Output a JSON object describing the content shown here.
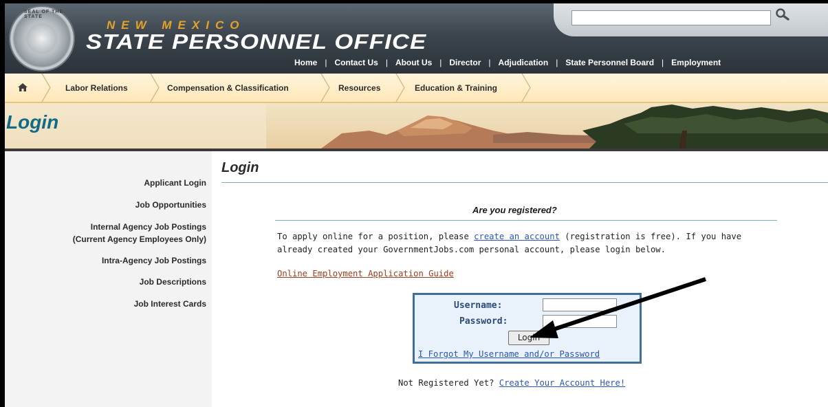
{
  "header": {
    "seal_text": "SEAL OF THE STATE",
    "state_name": "NEW MEXICO",
    "office_name": "STATE PERSONNEL OFFICE",
    "search": {
      "value": "",
      "placeholder": ""
    }
  },
  "topnav": [
    "Home",
    "Contact Us",
    "About Us",
    "Director",
    "Adjudication",
    "State Personnel Board",
    "Employment"
  ],
  "subnav": [
    "Labor Relations",
    "Compensation & Classification",
    "Resources",
    "Education & Training"
  ],
  "banner": {
    "title": "Login"
  },
  "sidebar": [
    "Applicant Login",
    "Job Opportunities",
    "Internal Agency Job Postings",
    "(Current Agency Employees Only)",
    "Intra-Agency Job Postings",
    "Job Descriptions",
    "Job Interest Cards"
  ],
  "main": {
    "title": "Login",
    "question": "Are you registered?",
    "intro_before": "To apply online for a position, please ",
    "intro_link": "create an account",
    "intro_after": " (registration is free). If you have already created your GovernmentJobs.com personal account, please login below.",
    "guide_link": "Online Employment Application Guide",
    "login": {
      "username_label": "Username:",
      "password_label": "Password:",
      "username_value": "",
      "password_value": "",
      "button": "Login",
      "forgot_link": "I Forgot My Username and/or Password"
    },
    "not_registered": "Not Registered Yet? ",
    "create_link": "Create Your Account Here!"
  },
  "colors": {
    "header_dark": "#3c454d",
    "accent_orange": "#e5a22a",
    "banner_title": "#0f6b86",
    "link_blue": "#2a56b4",
    "guide_link": "#9c3d1d",
    "login_border": "#3f6e9b"
  }
}
